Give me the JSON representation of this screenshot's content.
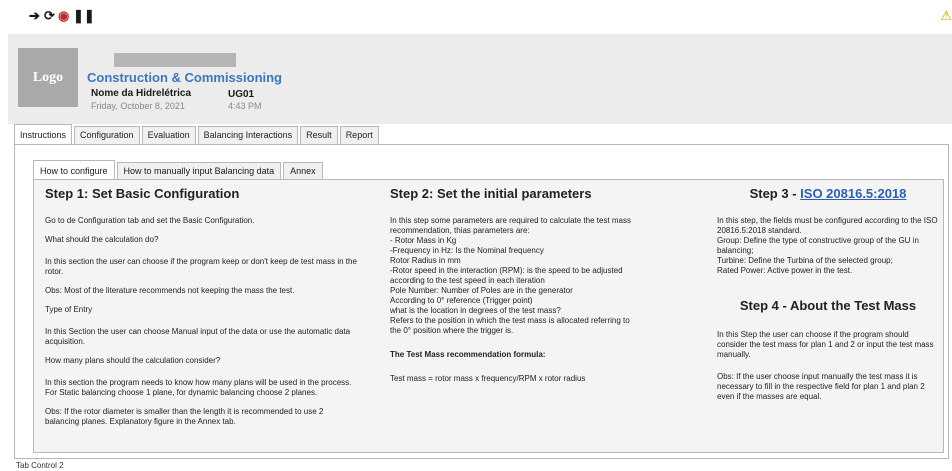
{
  "toolbar": {
    "icons": [
      "arrow-right-icon",
      "refresh-icon",
      "stop-icon",
      "pause-icon"
    ],
    "warning_icon": "warning-icon"
  },
  "header": {
    "logo": "Logo",
    "title": "Construction & Commissioning",
    "plant_name": "Nome da Hidrelétrica",
    "unit": "UG01",
    "date": "Friday, October 8, 2021",
    "time": "4:43 PM"
  },
  "main_tabs": [
    "Instructions",
    "Configuration",
    "Evaluation",
    "Balancing Interactions",
    "Result",
    "Report"
  ],
  "sub_tabs": [
    "How to configure",
    "How to manually input Balancing data",
    "Annex"
  ],
  "step1": {
    "title": "Step 1: Set Basic Configuration",
    "p1": "Go to de Configuration tab and set the Basic Configuration.",
    "q1": "What should the calculation do?",
    "p2": "In this section the user can choose if the program keep or don't keep de test mass in the rotor.",
    "p3": "Obs: Most of the literature recommends not keeping the mass the test.",
    "q2": "Type of Entry",
    "p4": "In this Section the user can choose Manual input of the data or use the automatic data acquisition.",
    "q3": "How many plans should the calculation consider?",
    "p5": "In this section the program needs to know how many plans will be used in the process. For Static balancing choose 1 plane, for dynamic balancing choose 2 planes.",
    "p6": "Obs: If the rotor diameter is smaller than the length it is recommended to use 2 balancing planes. Explanatory figure in the Annex tab."
  },
  "step2": {
    "title": "Step 2: Set the initial parameters",
    "lines": [
      "In this step some parameters are required to calculate the test mass recommendation, thias parameters are:",
      "- Rotor Mass in Kg",
      "-Frequency in Hz: Is the Nominal frequency",
      " Rotor Radius in mm",
      "-Rotor speed in the interaction (RPM): is the speed to be adjusted according to the test speed in each iteration",
      "Pole Number: Number of Poles are in the generator",
      "According to 0° reference (Trigger point)",
      "what is the location in degrees of the test mass?",
      "Refers to the position in which the test mass is allocated referring to the 0° position where the trigger is."
    ],
    "formula_title": "The Test Mass recommendation formula:",
    "formula": "Test mass = rotor mass x frequency/RPM x rotor radius"
  },
  "step3": {
    "title_prefix": "Step 3 - ",
    "title_link": "ISO 20816.5:2018",
    "p1": "In this step, the fields must be configured according to the ISO 20816.5:2018 standard.",
    "p2": "Group: Define the type of constructive group of the GU in balancing;",
    "p3": "Turbine: Define the Turbina of the selected group;",
    "p4": "Rated Power: Active power in the test."
  },
  "step4": {
    "title": "Step 4 - About the Test Mass",
    "p1": "In this Step the user can choose if the program should consider the test mass for plan 1 and 2 or input the test mass manually.",
    "p2": "Obs: If the user choose input manually the test mass it is necessary to fill in the respective field for plan 1 and plan 2 even if the masses are equal."
  },
  "footer": "Tab Control 2"
}
